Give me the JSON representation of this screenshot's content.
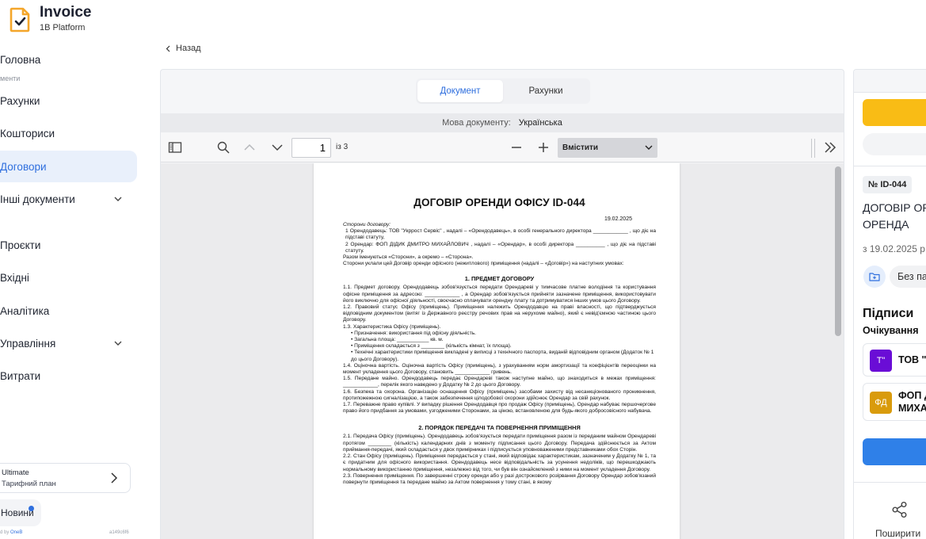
{
  "brand": {
    "title": "Invoice",
    "subtitle": "1B Platform"
  },
  "nav": {
    "home": "Головна",
    "section_documents": "менти",
    "invoices": "Рахунки",
    "estimates": "Кошториси",
    "contracts": "Договори",
    "other_docs": "Інші документи",
    "projects": "Проєкти",
    "incoming": "Вхідні",
    "analytics": "Аналітика",
    "management": "Управління",
    "expenses": "Витрати"
  },
  "plan": {
    "name": "Ultimate",
    "label": "Тарифний план"
  },
  "news": "Новини",
  "footer": {
    "powered_prefix": "d by",
    "powered_brand": "OneB",
    "version": "a149c6f6"
  },
  "back_label": "Назад",
  "viewer": {
    "tabs": [
      "Документ",
      "Рахунки"
    ],
    "language_label": "Мова документу:",
    "language_value": "Українська",
    "page_current": "1",
    "page_total": "із 3",
    "zoom_value": "Вмістити"
  },
  "document": {
    "title": "ДОГОВІР ОРЕНДИ ОФІСУ ID-044",
    "date": "19.02.2025",
    "lines": [
      "Сторони договору:",
      "1 Орендодавець: ТОВ \"Укррост Сервіс\" , надалі – «Орендодавець», в особі генерального директора ____________ , що діє на підставі статуту,",
      "2 Орендар: ФОП ДІДИК ДМИТРО МИХАЙЛОВИЧ , надалі – «Орендар», в особі директора __________ , що діє на підставі статуту.",
      "Разом іменуються «Сторони», а окремо – «Сторона».",
      "Сторони уклали цей Договір оренди офісного (нежитлового) приміщення (надалі – «Договір») на наступних умовах:"
    ],
    "section1": "1. ПРЕДМЕТ ДОГОВОРУ",
    "section1_lines": [
      "1.1. Предмет договору. Орендодавець зобов'язується передати Орендареві у тимчасове платне володіння та користування офісне приміщення за адресою: ____________ , а Орендар зобов'язується прийняти зазначене приміщення, використовувати його виключно для офісної діяльності, своєчасно сплачувати орендну плату та дотримуватися інших умов цього Договору.",
      "1.2. Правовий статус Офісу (приміщень). Приміщення належить Орендодавцю на праві власності, що підтверджується відповідним документом (витяг із Державного реєстру речових прав на нерухоме майно), який є невід'ємною частиною цього Договору.",
      "1.3. Характеристика Офісу (приміщень)."
    ],
    "bullets": [
      "Призначення: використання під офісну діяльність.",
      "Загальна площа: ___________ кв. м.",
      "Приміщення складається з ________ (кількість кімнат, їх площа).",
      "Технічні характеристики приміщення викладені у виписці з технічного паспорта, виданій відповідним органом (Додаток № 1 до цього Договору)."
    ],
    "section1_more": [
      "1.4. Оціночна вартість. Оціночна вартість Офісу (приміщень), з урахуванням норм амортизації та коефіцієнтів переоцінки на момент укладення цього Договору, становить ____________ гривень.",
      "1.5. Передане майно. Орендодавець передає Орендареві також наступне майно, що знаходиться в межах приміщення: ____________, перелік якого наведено у Додатку № 2 до цього Договору.",
      "1.6. Безпека та охорона. Організацію оснащення Офісу (приміщень) засобами захисту від несанкціонованого проникнення, протипожежною сигналізацією, а також забезпечення цілодобової охорони здійснює Орендар за свій рахунок.",
      "1.7. Переважне право купівлі. У випадку рішення Орендодавця про продаж Офісу (приміщень), Орендар набуває першочергове право його придбання за умовами, узгодженими Сторонами, за ціною, встановленою для будь-якого добросовісного набувача."
    ],
    "section2": "2. ПОРЯДОК ПЕРЕДАЧІ ТА ПОВЕРНЕННЯ ПРИМІЩЕННЯ",
    "section2_lines": [
      "2.1. Передача Офісу (приміщень). Орендодавець зобов'язується передати приміщення разом із переданим майном Орендареві протягом ________ (кількість) календарних днів з моменту підписання цього Договору. Передача здійснюється за Актом приймання-передачі, який складається у двох примірниках і підписується уповноваженими представниками обох Сторін.",
      "2.2. Стан Офісу (приміщень). Приміщення передається у стані, який відповідає характеристикам, зазначеним у Додатку № 1, та є придатним для офісного використання. Орендодавець несе відповідальність за усунення недоліків, що перешкоджають нормальному використанню приміщення, незалежно від того, чи був він ознайомлений з ними на момент укладення Договору.",
      "2.3. Повернення приміщення. По завершенні строку оренди або у разі дострокового розірвання Договору Орендар зобов'язаний повернути приміщення та передане майно за Актом повернення у тому стані, в якому"
    ]
  },
  "right_panel": {
    "doc_id": "№ ID-044",
    "title_line1": "ДОГОВІР ОРЕНДИ ОФІСУ",
    "title_line2": "ОРЕНДА",
    "date": "з 19.02.2025 р.",
    "no_folder": "Без папки",
    "signatures_heading": "Підписи",
    "waiting": "Очікування",
    "signers": [
      {
        "initials": "Т\"",
        "name_line1": "ТОВ \"Укррост Сервіс\"",
        "name_line2": "",
        "color": "#6a0dd6"
      },
      {
        "initials": "ФД",
        "name_line1": "ФОП ДІДИК ДМИТРО",
        "name_line2": "МИХАЙЛОВИЧ",
        "color": "#d99b0c"
      }
    ],
    "share_label": "Поширити"
  },
  "colors": {
    "accent": "#2f6fde",
    "yellow": "#f9bc15",
    "blue_button": "#2f80e8"
  }
}
